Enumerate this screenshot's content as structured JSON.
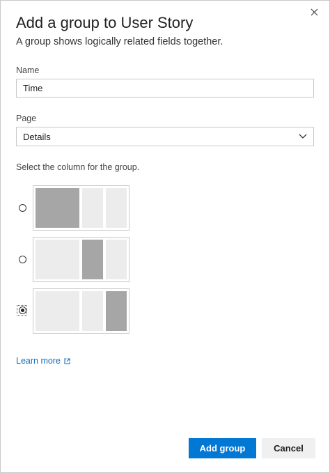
{
  "dialog": {
    "title": "Add a group to User Story",
    "subtitle": "A group shows logically related fields together.",
    "close_icon": "close-icon"
  },
  "name_field": {
    "label": "Name",
    "value": "Time"
  },
  "page_field": {
    "label": "Page",
    "selected": "Details",
    "icon": "chevron-down-icon"
  },
  "column_select": {
    "instruction": "Select the column for the group.",
    "options": [
      {
        "column": 1,
        "selected": false
      },
      {
        "column": 2,
        "selected": false
      },
      {
        "column": 3,
        "selected": true
      }
    ]
  },
  "learn_more": {
    "label": "Learn more",
    "icon": "external-link-icon"
  },
  "footer": {
    "primary_label": "Add group",
    "secondary_label": "Cancel"
  },
  "colors": {
    "primary": "#0078d4",
    "link": "#106ebe",
    "active_column": "#a6a6a6",
    "inactive_column": "#ececec"
  }
}
